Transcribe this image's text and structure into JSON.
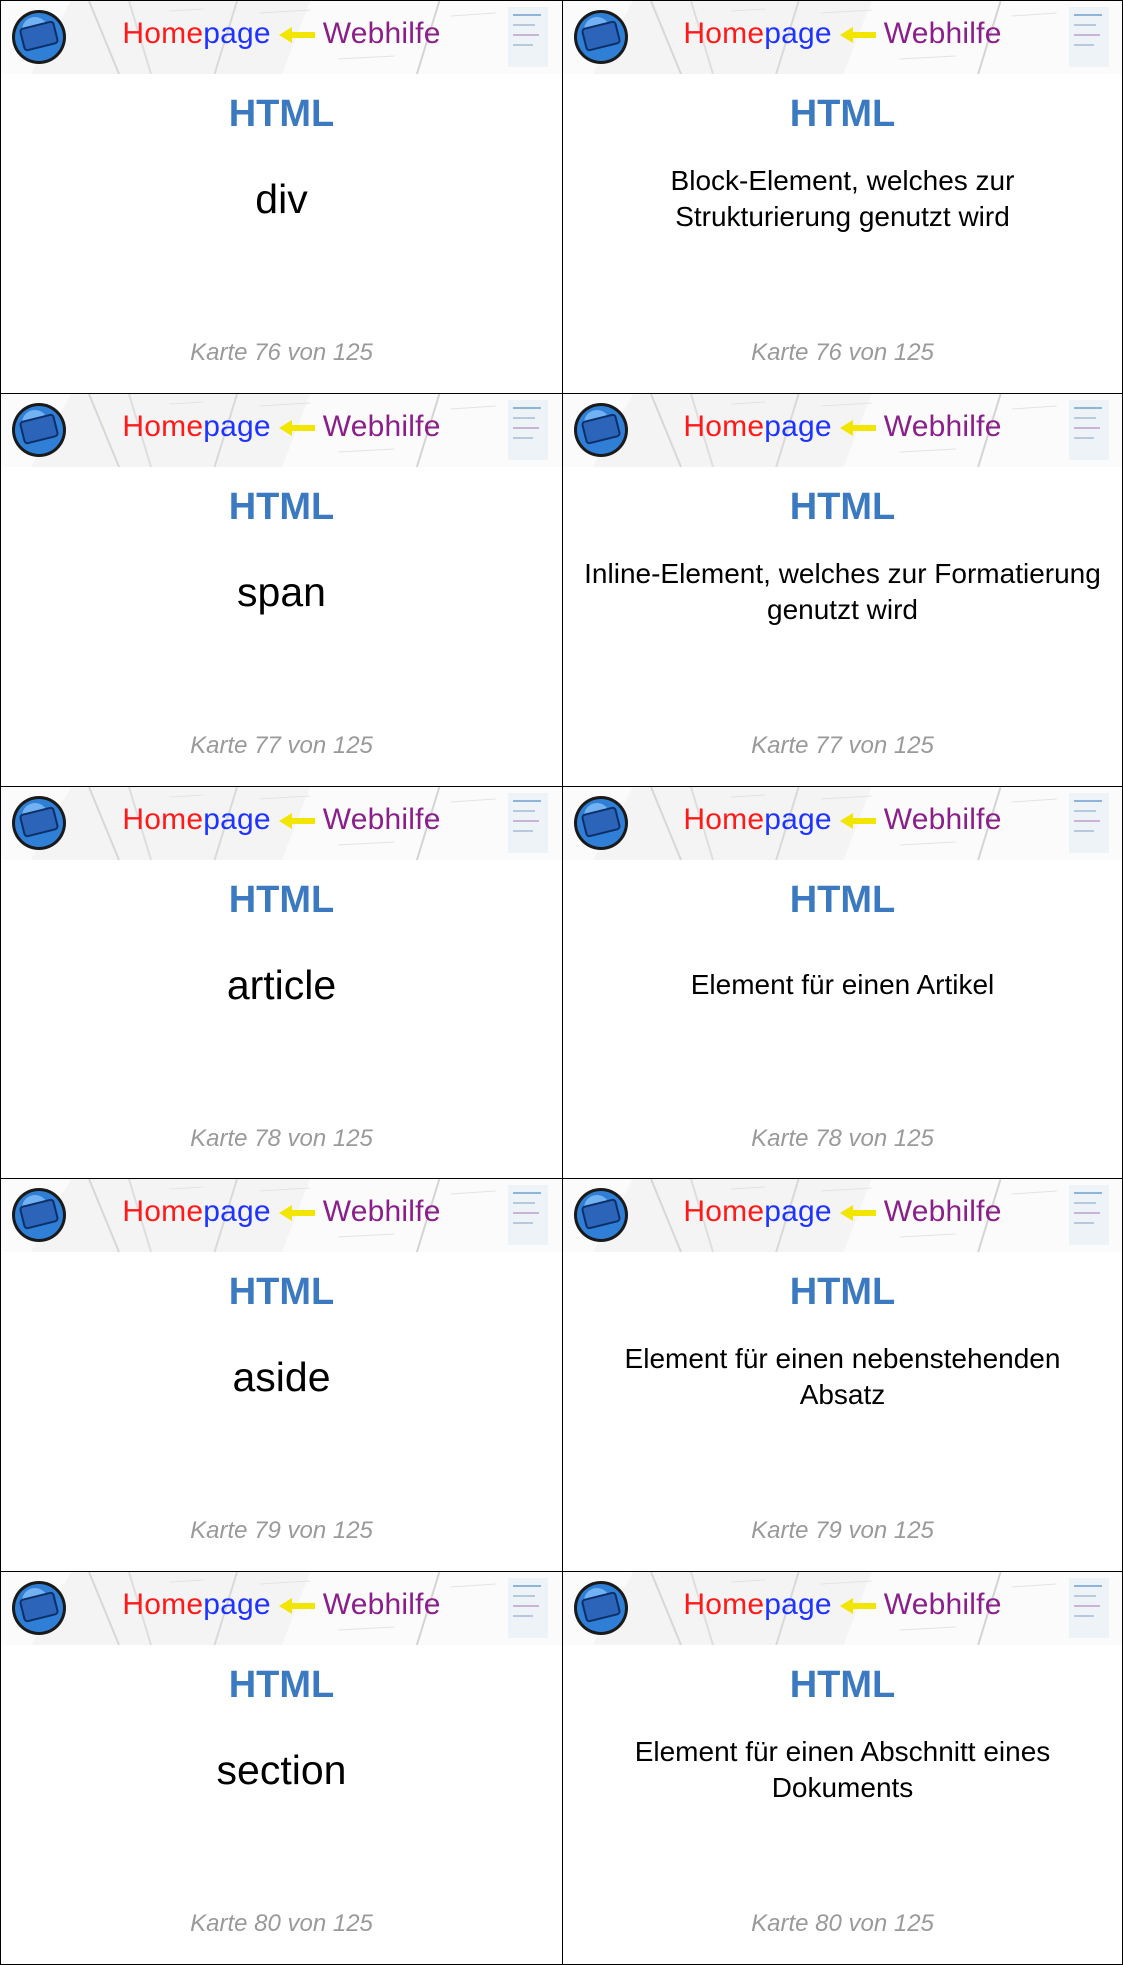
{
  "brand": {
    "part1": "Home",
    "part2": "page",
    "part3": "Webhilfe"
  },
  "cards": [
    {
      "subject": "HTML",
      "front": "div",
      "back": "Block-Element, welches zur Strukturierung genutzt wird",
      "footer": "Karte 76 von 125"
    },
    {
      "subject": "HTML",
      "front": "span",
      "back": "Inline-Element, welches zur Formatierung genutzt wird",
      "footer": "Karte 77 von 125"
    },
    {
      "subject": "HTML",
      "front": "article",
      "back": "Element für einen Artikel",
      "footer": "Karte 78 von 125"
    },
    {
      "subject": "HTML",
      "front": "aside",
      "back": "Element für einen nebenstehenden Absatz",
      "footer": "Karte 79 von 125"
    },
    {
      "subject": "HTML",
      "front": "section",
      "back": "Element für einen Abschnitt eines Dokuments",
      "footer": "Karte 80 von 125"
    }
  ],
  "colors": {
    "subject": "#3b7ac0",
    "footer": "#9a9a9a",
    "home": "#ff1a1a",
    "page": "#1f33ff",
    "web": "#8a1f8a",
    "arrow": "#f2e600"
  }
}
